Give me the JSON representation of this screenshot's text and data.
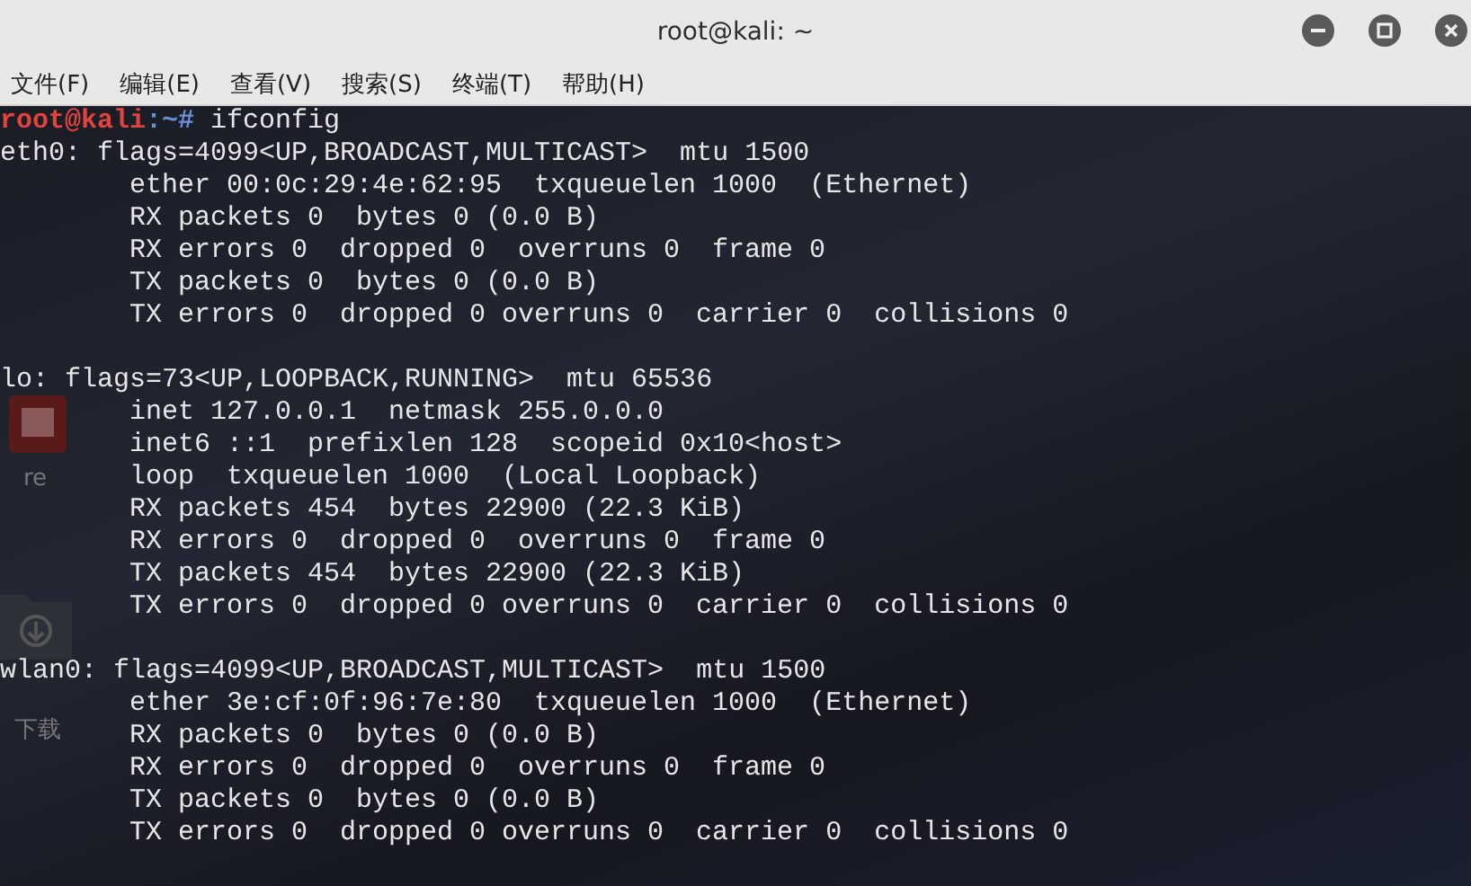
{
  "window": {
    "title": "root@kali: ~"
  },
  "menu": [
    "文件(F)",
    "编辑(E)",
    "查看(V)",
    "搜索(S)",
    "终端(T)",
    "帮助(H)"
  ],
  "desktop_labels": [
    "re",
    "下载"
  ],
  "terminal": [
    {
      "kind": "prompt",
      "user": "root@kali",
      "path": ":~",
      "symbol": "#",
      "command": "ifconfig"
    },
    {
      "kind": "output",
      "indented": false,
      "text": "eth0: flags=4099<UP,BROADCAST,MULTICAST>  mtu 1500"
    },
    {
      "kind": "output",
      "indented": true,
      "text": "ether 00:0c:29:4e:62:95  txqueuelen 1000  (Ethernet)"
    },
    {
      "kind": "output",
      "indented": true,
      "text": "RX packets 0  bytes 0 (0.0 B)"
    },
    {
      "kind": "output",
      "indented": true,
      "text": "RX errors 0  dropped 0  overruns 0  frame 0"
    },
    {
      "kind": "output",
      "indented": true,
      "text": "TX packets 0  bytes 0 (0.0 B)"
    },
    {
      "kind": "output",
      "indented": true,
      "text": "TX errors 0  dropped 0 overruns 0  carrier 0  collisions 0"
    },
    {
      "kind": "blank"
    },
    {
      "kind": "output",
      "indented": false,
      "text": "lo: flags=73<UP,LOOPBACK,RUNNING>  mtu 65536"
    },
    {
      "kind": "output",
      "indented": true,
      "text": "inet 127.0.0.1  netmask 255.0.0.0"
    },
    {
      "kind": "output",
      "indented": true,
      "text": "inet6 ::1  prefixlen 128  scopeid 0x10<host>"
    },
    {
      "kind": "output",
      "indented": true,
      "text": "loop  txqueuelen 1000  (Local Loopback)"
    },
    {
      "kind": "output",
      "indented": true,
      "text": "RX packets 454  bytes 22900 (22.3 KiB)"
    },
    {
      "kind": "output",
      "indented": true,
      "text": "RX errors 0  dropped 0  overruns 0  frame 0"
    },
    {
      "kind": "output",
      "indented": true,
      "text": "TX packets 454  bytes 22900 (22.3 KiB)"
    },
    {
      "kind": "output",
      "indented": true,
      "text": "TX errors 0  dropped 0 overruns 0  carrier 0  collisions 0"
    },
    {
      "kind": "blank"
    },
    {
      "kind": "output",
      "indented": false,
      "text": "wlan0: flags=4099<UP,BROADCAST,MULTICAST>  mtu 1500"
    },
    {
      "kind": "output",
      "indented": true,
      "text": "ether 3e:cf:0f:96:7e:80  txqueuelen 1000  (Ethernet)"
    },
    {
      "kind": "output",
      "indented": true,
      "text": "RX packets 0  bytes 0 (0.0 B)"
    },
    {
      "kind": "output",
      "indented": true,
      "text": "RX errors 0  dropped 0  overruns 0  frame 0"
    },
    {
      "kind": "output",
      "indented": true,
      "text": "TX packets 0  bytes 0 (0.0 B)"
    },
    {
      "kind": "output",
      "indented": true,
      "text": "TX errors 0  dropped 0 overruns 0  carrier 0  collisions 0"
    }
  ]
}
